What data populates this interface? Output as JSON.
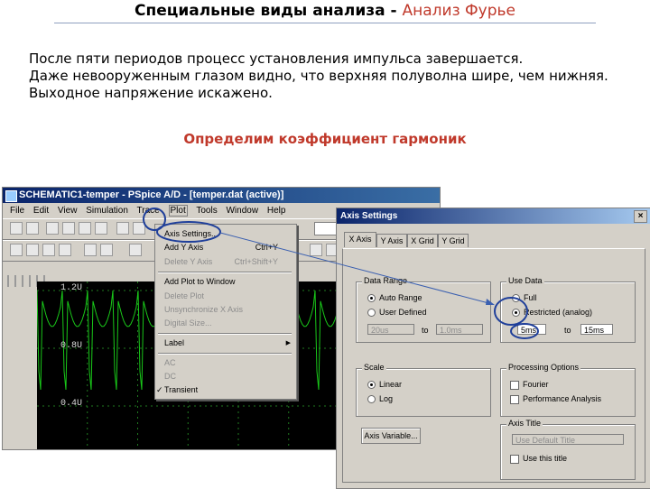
{
  "slide": {
    "title_main": "Специальные виды анализа - ",
    "title_accent": "Анализ Фурье",
    "paragraph": [
      "После пяти периодов процесс установления импульса завершается.",
      "Даже невооруженным глазом видно, что верхняя полуволна шире, чем нижняя.",
      "Выходное напряжение искажено."
    ],
    "subheading": "Определим коэффициент гармоник"
  },
  "pspice": {
    "title": "SCHEMATIC1-temper - PSpice A/D - [temper.dat (active)]",
    "menu": [
      "File",
      "Edit",
      "View",
      "Simulation",
      "Trace",
      "Plot",
      "Tools",
      "Window",
      "Help"
    ],
    "active_menu_index": 5,
    "y_labels": [
      "1.2U",
      "0.8U",
      "0.4U"
    ]
  },
  "plot_menu": {
    "items": [
      {
        "label": "Axis Settings...",
        "shortcut": "",
        "disabled": false
      },
      {
        "label": "Add Y Axis",
        "shortcut": "Ctrl+Y",
        "disabled": false
      },
      {
        "label": "Delete Y Axis",
        "shortcut": "Ctrl+Shift+Y",
        "disabled": true
      },
      {
        "label": "Add Plot to Window",
        "shortcut": "",
        "disabled": false
      },
      {
        "label": "Delete Plot",
        "shortcut": "",
        "disabled": true
      },
      {
        "label": "Unsynchronize X Axis",
        "shortcut": "",
        "disabled": true
      },
      {
        "label": "Digital Size...",
        "shortcut": "",
        "disabled": true
      },
      {
        "label": "Label",
        "shortcut": "",
        "disabled": false
      },
      {
        "label": "AC",
        "shortcut": "",
        "disabled": true
      },
      {
        "label": "DC",
        "shortcut": "",
        "disabled": true
      },
      {
        "label": "Transient",
        "shortcut": "",
        "disabled": false
      }
    ]
  },
  "dialog": {
    "title": "Axis Settings",
    "close": "×",
    "tabs": [
      "X Axis",
      "Y Axis",
      "X Grid",
      "Y Grid"
    ],
    "data_range": {
      "label": "Data Range",
      "auto": "Auto Range",
      "user": "User Defined",
      "from": "20us",
      "to_word": "to",
      "to": "1.0ms"
    },
    "use_data": {
      "label": "Use Data",
      "full": "Full",
      "restricted": "Restricted (analog)",
      "from": "5ms",
      "to_word": "to",
      "to": "15ms"
    },
    "scale": {
      "label": "Scale",
      "linear": "Linear",
      "log": "Log"
    },
    "processing": {
      "label": "Processing Options",
      "fourier": "Fourier",
      "performance": "Performance Analysis"
    },
    "axis_title": {
      "label": "Axis Title",
      "default": "Use Default Title",
      "use_title": "Use this title"
    },
    "axis_variable_button": "Axis Variable..."
  },
  "colors": {
    "accent": "#c0392b",
    "annotation": "#1f3f9a",
    "trace": "#19c819",
    "grid": "#1f7a1f"
  }
}
